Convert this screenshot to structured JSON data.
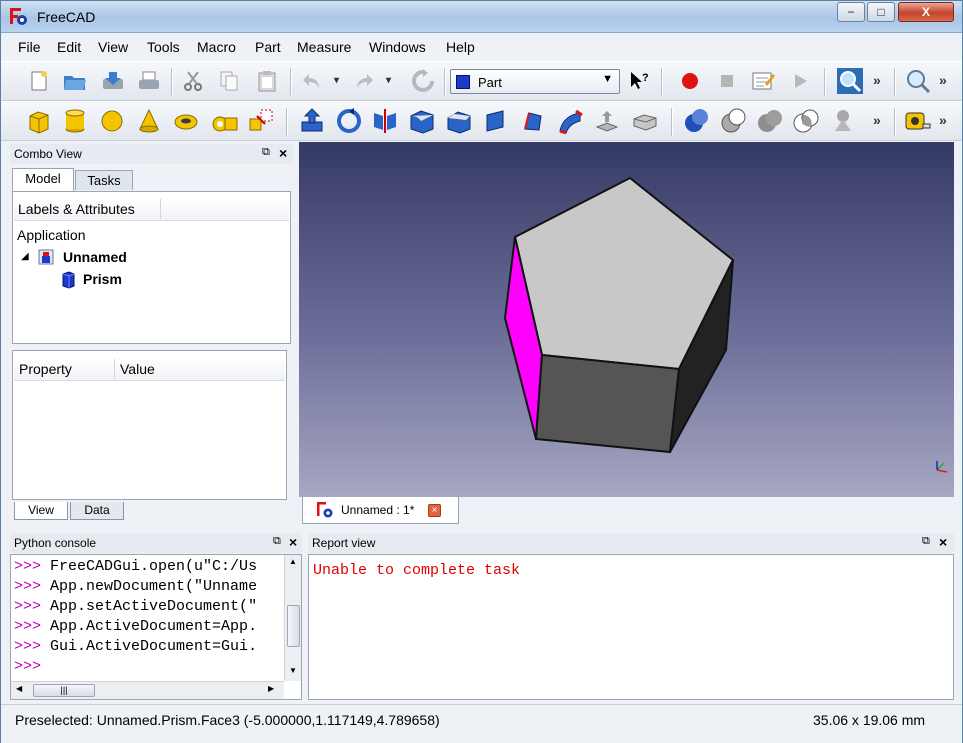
{
  "window": {
    "title": "FreeCAD",
    "caption_buttons": {
      "minimize": "−",
      "maximize": "□",
      "close": "X"
    }
  },
  "menu": [
    "File",
    "Edit",
    "View",
    "Tools",
    "Macro",
    "Part",
    "Measure",
    "Windows",
    "Help"
  ],
  "toolbar": {
    "workbench_selected": "Part",
    "more": "»"
  },
  "combo_view": {
    "title": "Combo View",
    "tabs": [
      "Model",
      "Tasks"
    ],
    "tree_header": "Labels & Attributes",
    "tree": {
      "root": "Application",
      "document": "Unnamed",
      "object": "Prism"
    },
    "property_headers": [
      "Property",
      "Value"
    ],
    "property_tabs": [
      "View",
      "Data"
    ]
  },
  "viewport": {
    "document_tab": "Unnamed : 1*",
    "colors": {
      "top_face": "#c8c8c8",
      "selected_face": "#ff00ff",
      "front_face": "#555555",
      "side_face": "#222222"
    }
  },
  "python_console": {
    "title": "Python console",
    "prompt": ">>>",
    "lines": [
      "FreeCADGui.open(u\"C:/Us",
      "App.newDocument(\"Unname",
      "App.setActiveDocument(\"",
      "App.ActiveDocument=App.",
      "Gui.ActiveDocument=Gui.",
      ""
    ]
  },
  "report_view": {
    "title": "Report view",
    "message": "Unable to complete task",
    "message_color": "#e00000"
  },
  "status": {
    "message": "Preselected: Unnamed.Prism.Face3 (-5.000000,1.117149,4.789658)",
    "dimensions": "35.06 x 19.06 mm"
  }
}
